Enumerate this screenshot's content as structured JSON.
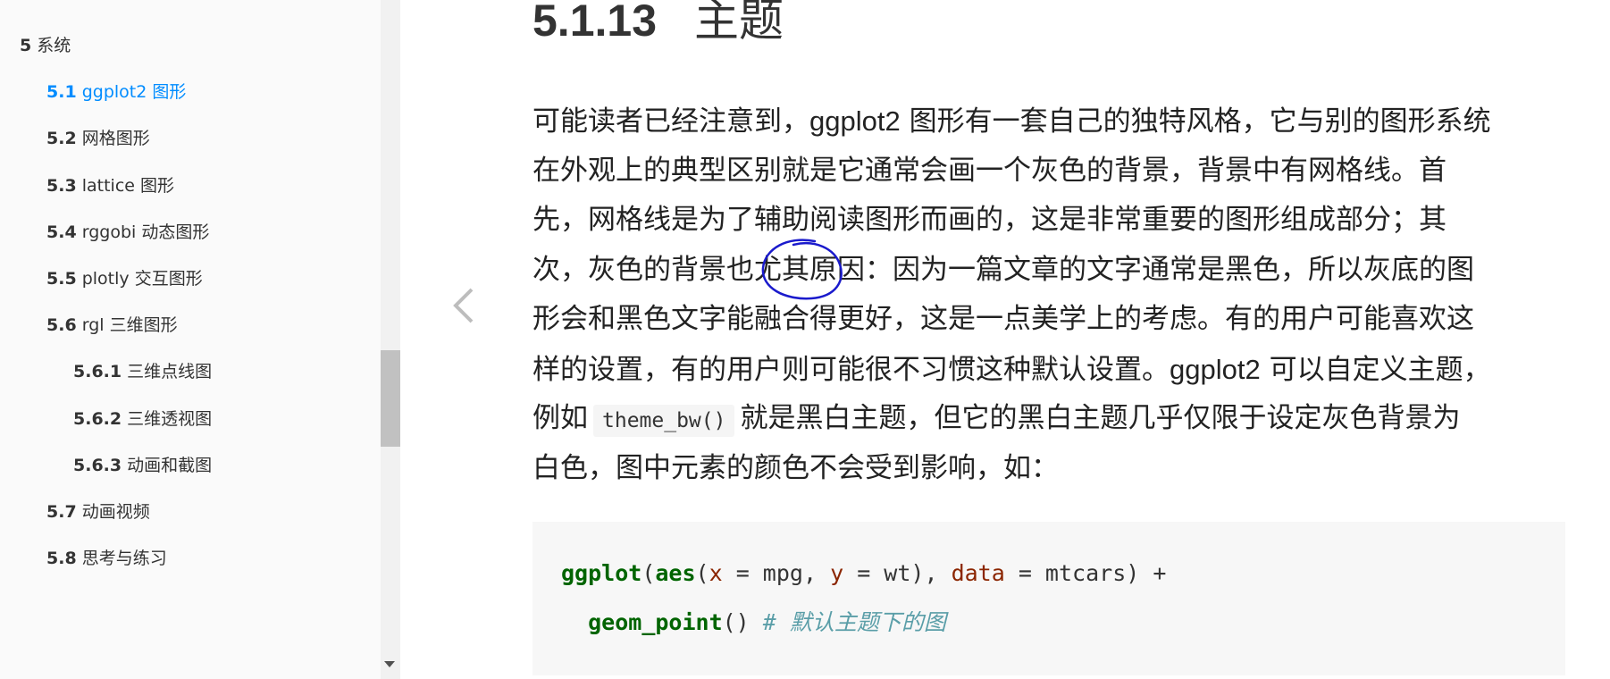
{
  "sidebar": {
    "items": [
      {
        "num": "5",
        "label": "系统",
        "level": 1,
        "active": false
      },
      {
        "num": "5.1",
        "label": "ggplot2 图形",
        "level": 2,
        "active": true
      },
      {
        "num": "5.2",
        "label": "网格图形",
        "level": 2,
        "active": false
      },
      {
        "num": "5.3",
        "label": "lattice 图形",
        "level": 2,
        "active": false
      },
      {
        "num": "5.4",
        "label": "rggobi 动态图形",
        "level": 2,
        "active": false
      },
      {
        "num": "5.5",
        "label": "plotly 交互图形",
        "level": 2,
        "active": false
      },
      {
        "num": "5.6",
        "label": "rgl 三维图形",
        "level": 2,
        "active": false
      },
      {
        "num": "5.6.1",
        "label": "三维点线图",
        "level": 3,
        "active": false
      },
      {
        "num": "5.6.2",
        "label": "三维透视图",
        "level": 3,
        "active": false
      },
      {
        "num": "5.6.3",
        "label": "动画和截图",
        "level": 3,
        "active": false
      },
      {
        "num": "5.7",
        "label": "动画视频",
        "level": 2,
        "active": false
      },
      {
        "num": "5.8",
        "label": "思考与练习",
        "level": 2,
        "active": false
      }
    ]
  },
  "nav": {
    "prev_glyph": "‹"
  },
  "section": {
    "number": "5.1.13",
    "title": "主题"
  },
  "paragraph": {
    "l1a": "可能读者已经注意到，",
    "l1b": "ggplot2",
    "l1c": " 图形有一套自己的独特风格，它与别的图形系统",
    "l2": "在外观上的典型区别就是它通常会画一个灰色的背景，背景中有网格线。首",
    "l3": "先，网格线是为了辅助阅读图形而画的，这是非常重要的图形组成部分；其",
    "l4": "次，灰色的背景也尤其原因：因为一篇文章的文字通常是黑色，所以灰底的图",
    "l5": "形会和黑色文字能融合得更好，这是一点美学上的考虑。有的用户可能喜欢这",
    "l6a": "样的设置，有的用户则可能很不习惯这种默认设置。",
    "l6b": "ggplot2",
    "l6c": " 可以自定义主题，",
    "l7a": "例如",
    "l7code": "theme_bw()",
    "l7b": "就是黑白主题，但它的黑白主题几乎仅限于设定灰色背景为",
    "l8": "白色，图中元素的颜色不会受到影响，如："
  },
  "code": {
    "line1": {
      "fn1": "ggplot",
      "p1": "(",
      "fn2": "aes",
      "p2": "(",
      "a1": "x",
      "o1": " = mpg, ",
      "a2": "y",
      "o2": " = wt), ",
      "a3": "data",
      "o3": " = mtcars) +"
    },
    "line2": {
      "indent": "  ",
      "fn": "geom_point",
      "p": "() ",
      "comment": "# 默认主题下的图"
    }
  },
  "colors": {
    "active_link": "#008cff",
    "annotation": "#1a1acc",
    "code_fn": "#006400",
    "code_arg": "#8b2500",
    "code_comment": "#5a9ea8"
  }
}
